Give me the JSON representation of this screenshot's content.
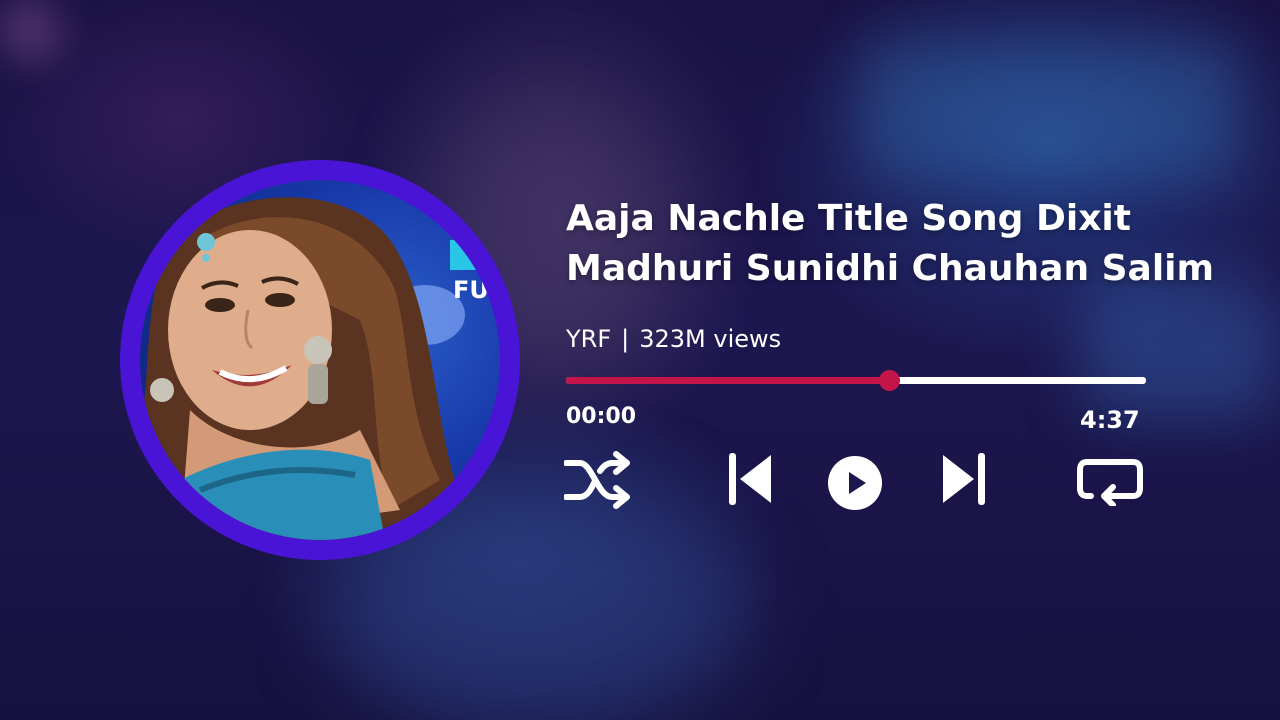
{
  "song": {
    "title": "Aaja Nachle Title Song Dixit\nMadhuri Sunidhi Chauhan Salim",
    "channel": "YRF",
    "separator": "|",
    "views": "323M views"
  },
  "artwork": {
    "logo_text": "FU",
    "ring_color": "#4a14d6"
  },
  "progress": {
    "current_time": "00:00",
    "total_time": "4:37",
    "fraction": 0.557,
    "played_color": "#c4154a",
    "remaining_color": "#ffffff"
  },
  "controls": {
    "shuffle_icon": "shuffle-icon",
    "previous_icon": "skip-previous-icon",
    "play_icon": "play-icon",
    "next_icon": "skip-next-icon",
    "repeat_icon": "repeat-icon"
  }
}
